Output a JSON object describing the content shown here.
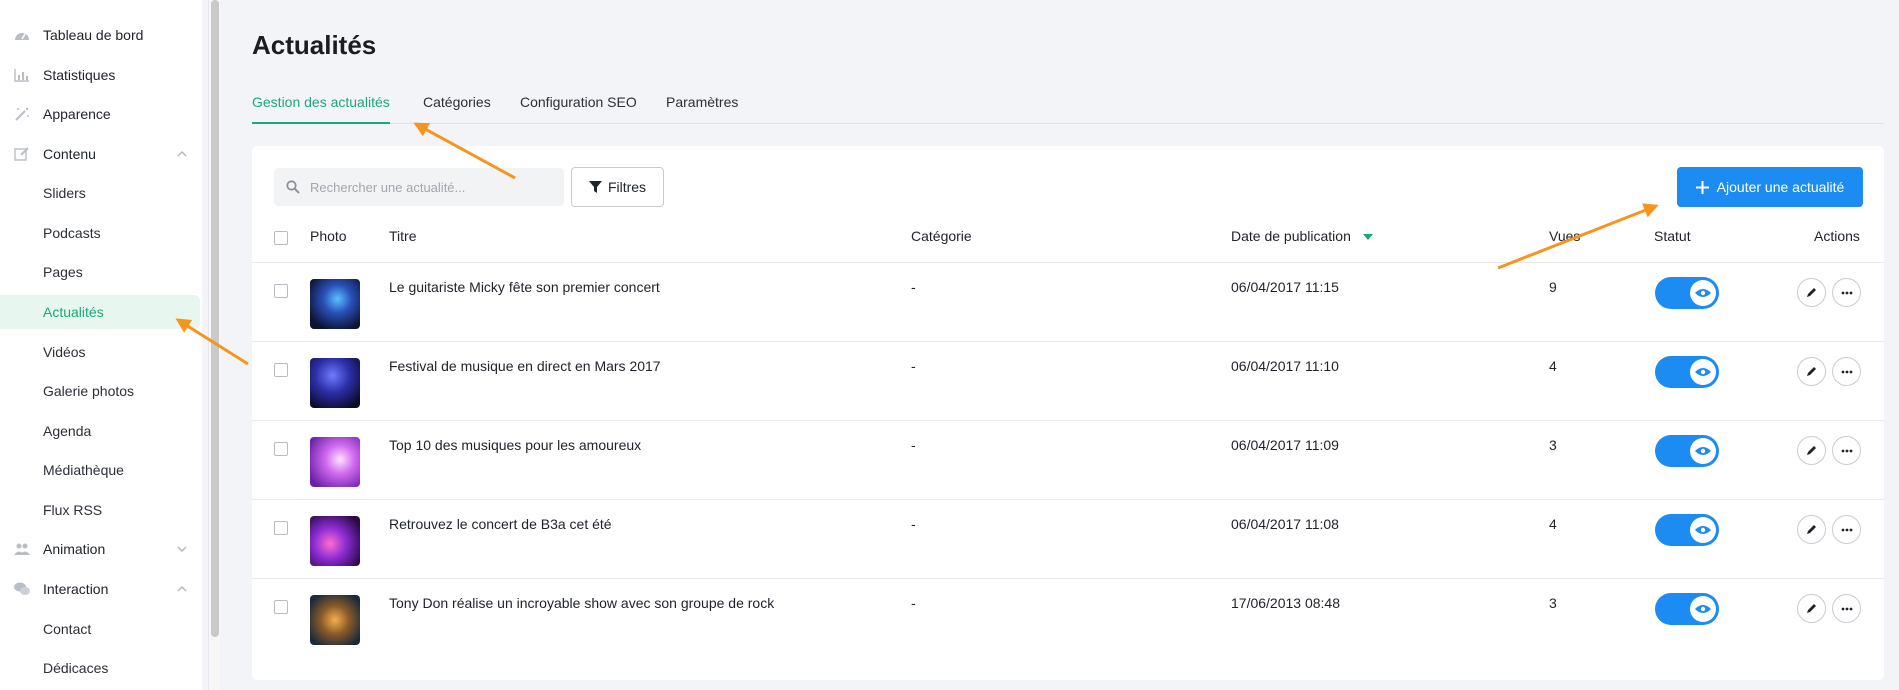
{
  "colors": {
    "accent_green": "#19a97a",
    "primary_blue": "#1c8cf2",
    "annotation_orange": "#f7941d"
  },
  "sidebar": {
    "items": [
      {
        "label": "Tableau de bord",
        "icon": "dashboard-icon",
        "level": 0
      },
      {
        "label": "Statistiques",
        "icon": "bar-chart-icon",
        "level": 0
      },
      {
        "label": "Apparence",
        "icon": "magic-wand-icon",
        "level": 0
      },
      {
        "label": "Contenu",
        "icon": "edit-icon",
        "level": 0,
        "expanded": true
      },
      {
        "label": "Sliders",
        "level": 1
      },
      {
        "label": "Podcasts",
        "level": 1
      },
      {
        "label": "Pages",
        "level": 1
      },
      {
        "label": "Actualités",
        "level": 1,
        "active": true
      },
      {
        "label": "Vidéos",
        "level": 1
      },
      {
        "label": "Galerie photos",
        "level": 1
      },
      {
        "label": "Agenda",
        "level": 1
      },
      {
        "label": "Médiathèque",
        "level": 1
      },
      {
        "label": "Flux RSS",
        "level": 1
      },
      {
        "label": "Animation",
        "icon": "users-icon",
        "level": 0,
        "expanded": false
      },
      {
        "label": "Interaction",
        "icon": "chat-icon",
        "level": 0,
        "expanded": true
      },
      {
        "label": "Contact",
        "level": 1
      },
      {
        "label": "Dédicaces",
        "level": 1
      }
    ]
  },
  "header": {
    "title": "Actualités",
    "tabs": [
      {
        "label": "Gestion des actualités",
        "active": true
      },
      {
        "label": "Catégories"
      },
      {
        "label": "Configuration SEO"
      },
      {
        "label": "Paramètres"
      }
    ]
  },
  "toolbar": {
    "search_placeholder": "Rechercher une actualité...",
    "filter_label": "Filtres",
    "add_label": "Ajouter une actualité"
  },
  "table": {
    "columns": {
      "photo": "Photo",
      "title": "Titre",
      "category": "Catégorie",
      "date": "Date de publication",
      "views": "Vues",
      "status": "Statut",
      "actions": "Actions"
    },
    "sort_column": "date",
    "rows": [
      {
        "title": "Le guitariste Micky fête son premier concert",
        "category": "-",
        "date": "06/04/2017 11:15",
        "views": "9",
        "published": true
      },
      {
        "title": "Festival de musique en direct en Mars 2017",
        "category": "-",
        "date": "06/04/2017 11:10",
        "views": "4",
        "published": true
      },
      {
        "title": "Top 10 des musiques pour les amoureux",
        "category": "-",
        "date": "06/04/2017 11:09",
        "views": "3",
        "published": true
      },
      {
        "title": "Retrouvez le concert de B3a cet été",
        "category": "-",
        "date": "06/04/2017 11:08",
        "views": "4",
        "published": true
      },
      {
        "title": "Tony Don réalise un incroyable show avec son groupe de rock",
        "category": "-",
        "date": "17/06/2013 08:48",
        "views": "3",
        "published": true
      }
    ]
  }
}
